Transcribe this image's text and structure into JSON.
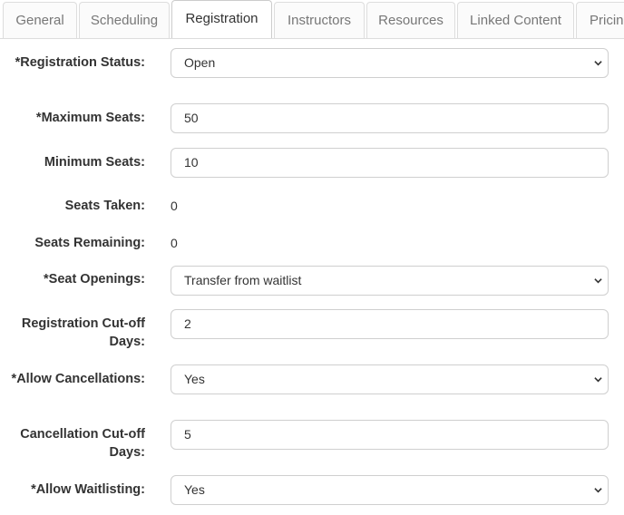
{
  "tabs": [
    {
      "label": "General"
    },
    {
      "label": "Scheduling"
    },
    {
      "label": "Registration"
    },
    {
      "label": "Instructors"
    },
    {
      "label": "Resources"
    },
    {
      "label": "Linked Content"
    },
    {
      "label": "Pricing"
    }
  ],
  "active_tab": "Registration",
  "form": {
    "registration_status": {
      "label": "*Registration Status:",
      "value": "Open"
    },
    "maximum_seats": {
      "label": "*Maximum Seats:",
      "value": "50"
    },
    "minimum_seats": {
      "label": "Minimum Seats:",
      "value": "10"
    },
    "seats_taken": {
      "label": "Seats Taken:",
      "value": "0"
    },
    "seats_remaining": {
      "label": "Seats Remaining:",
      "value": "0"
    },
    "seat_openings": {
      "label": "*Seat Openings:",
      "value": "Transfer from waitlist"
    },
    "registration_cutoff_days": {
      "label": "Registration Cut-off Days:",
      "value": "2"
    },
    "allow_cancellations": {
      "label": "*Allow Cancellations:",
      "value": "Yes"
    },
    "cancellation_cutoff_days": {
      "label": "Cancellation Cut-off Days:",
      "value": "5"
    },
    "allow_waitlisting": {
      "label": "*Allow Waitlisting:",
      "value": "Yes"
    }
  },
  "icons": {
    "dropdown": "chevron-down-icon"
  },
  "colors": {
    "border": "#cfcfcf",
    "tab_border": "#dddddd",
    "inactive_tab_text": "#777777"
  }
}
